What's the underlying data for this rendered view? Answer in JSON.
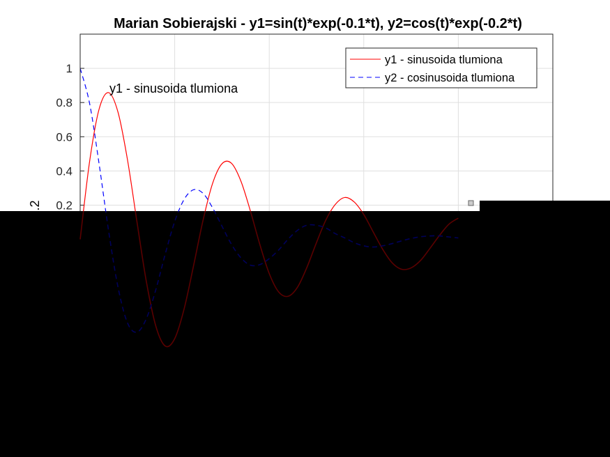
{
  "chart_data": {
    "type": "line",
    "title": "Marian Sobierajski - y1=sin(t)*exp(-0.1*t), y2=cos(t)*exp(-0.2*t)",
    "xlabel": "",
    "ylabel": "...2",
    "xlim": [
      0,
      25
    ],
    "ylim": [
      -1,
      1.2
    ],
    "yticks": [
      1,
      0.8,
      0.6,
      0.4,
      0.2
    ],
    "grid": true,
    "legend_position": "top-right",
    "annotation": "y1 - sinusoida tlumiona",
    "x": [
      0,
      0.5,
      1,
      1.5,
      2,
      2.5,
      3,
      3.5,
      4,
      4.5,
      5,
      5.5,
      6,
      6.5,
      7,
      7.5,
      8,
      8.5,
      9,
      9.5,
      10,
      10.5,
      11,
      11.5,
      12,
      12.5,
      13,
      13.5,
      14,
      14.5,
      15,
      15.5,
      16,
      16.5,
      17,
      17.5,
      18,
      18.5,
      19,
      19.5,
      20
    ],
    "series": [
      {
        "name": "y1 - sinusoida tlumiona",
        "color": "#ff0000",
        "style": "solid",
        "values": [
          0,
          0.456,
          0.761,
          0.858,
          0.744,
          0.467,
          0.105,
          -0.247,
          -0.507,
          -0.624,
          -0.581,
          -0.406,
          -0.153,
          0.112,
          0.326,
          0.442,
          0.445,
          0.341,
          0.167,
          -0.029,
          -0.2,
          -0.308,
          -0.333,
          -0.279,
          -0.162,
          -0.019,
          0.114,
          0.205,
          0.245,
          0.218,
          0.145,
          0.043,
          -0.058,
          -0.137,
          -0.175,
          -0.167,
          -0.124,
          -0.053,
          0.022,
          0.088,
          0.124
        ]
      },
      {
        "name": "y2 - cosinusoida tlumiona",
        "color": "#0000ff",
        "style": "dashed",
        "values": [
          1,
          0.794,
          0.442,
          0.052,
          -0.279,
          -0.488,
          -0.543,
          -0.464,
          -0.295,
          -0.086,
          0.104,
          0.234,
          0.29,
          0.269,
          0.185,
          0.077,
          -0.029,
          -0.108,
          -0.151,
          -0.148,
          -0.113,
          -0.062,
          0.001,
          0.053,
          0.083,
          0.082,
          0.066,
          0.033,
          0.008,
          -0.02,
          -0.038,
          -0.045,
          -0.038,
          -0.025,
          -0.009,
          0.005,
          0.015,
          0.02,
          0.02,
          0.014,
          0.008
        ]
      }
    ]
  }
}
